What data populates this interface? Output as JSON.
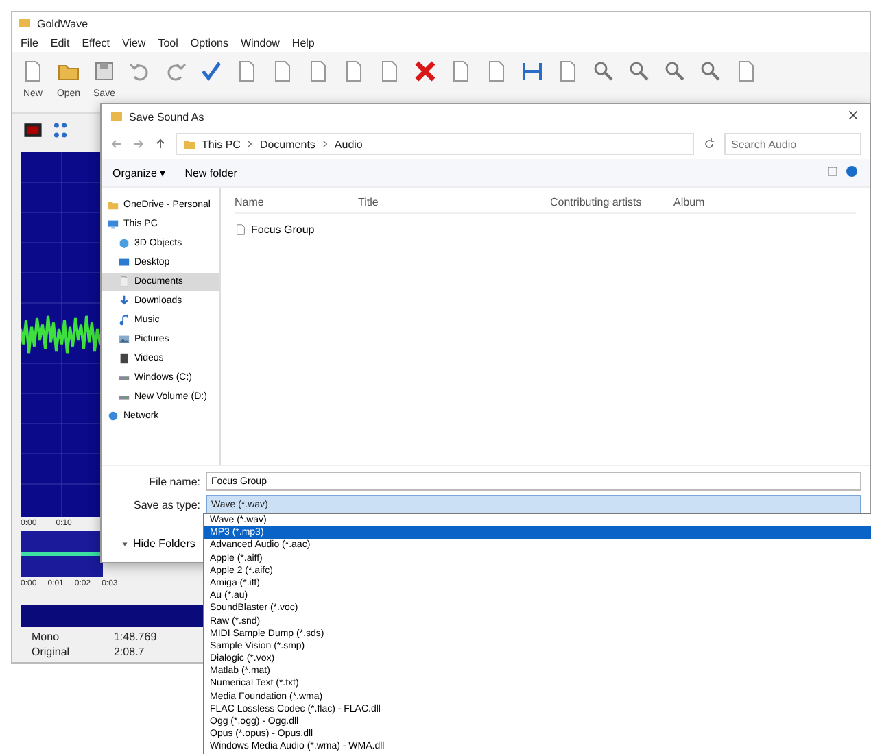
{
  "app": {
    "title": "GoldWave",
    "menu": [
      "File",
      "Edit",
      "Effect",
      "View",
      "Tool",
      "Options",
      "Window",
      "Help"
    ],
    "toolbar": [
      "New",
      "Open",
      "Save"
    ]
  },
  "waveform": {
    "time_labels": [
      "0:00",
      "0:10"
    ],
    "overview_labels": [
      "0:00",
      "0:01",
      "0:02",
      "0:03"
    ]
  },
  "status_bar": [
    {
      "label": "Mono",
      "value": "1:48.769"
    },
    {
      "label": "Original",
      "value": "2:08.7"
    }
  ],
  "dialog": {
    "title": "Save Sound As",
    "path": [
      "This PC",
      "Documents",
      "Audio"
    ],
    "search": {
      "placeholder": "Search Audio"
    },
    "commands": [
      "Organize ▾",
      "New folder"
    ],
    "nav": [
      {
        "label": "OneDrive - Personal",
        "selected": false
      },
      {
        "label": "This PC",
        "selected": false,
        "children": [
          {
            "label": "3D Objects",
            "selected": false
          },
          {
            "label": "Desktop",
            "selected": false
          },
          {
            "label": "Documents",
            "selected": true
          },
          {
            "label": "Downloads",
            "selected": false
          },
          {
            "label": "Music",
            "selected": false
          },
          {
            "label": "Pictures",
            "selected": false
          },
          {
            "label": "Videos",
            "selected": false
          },
          {
            "label": "Windows (C:)",
            "selected": false
          },
          {
            "label": "New Volume (D:)",
            "selected": false
          }
        ]
      },
      {
        "label": "Network",
        "selected": false
      }
    ],
    "columns": [
      "Name",
      "Title",
      "Contributing artists",
      "Album"
    ],
    "files": [
      {
        "name": "Focus Group"
      }
    ],
    "file_name": {
      "label": "File name:",
      "value": "Focus Group"
    },
    "save_type": {
      "label": "Save as type:",
      "value": "Wave (*.wav)"
    },
    "hide_folders": "Hide Folders",
    "type_options": [
      {
        "label": "Wave (*.wav)",
        "selected": false
      },
      {
        "label": "MP3 (*.mp3)",
        "selected": true
      },
      {
        "label": "Advanced Audio (*.aac)",
        "selected": false
      },
      {
        "label": "Apple (*.aiff)",
        "selected": false
      },
      {
        "label": "Apple 2 (*.aifc)",
        "selected": false
      },
      {
        "label": "Amiga (*.iff)",
        "selected": false
      },
      {
        "label": "Au (*.au)",
        "selected": false
      },
      {
        "label": "SoundBlaster (*.voc)",
        "selected": false
      },
      {
        "label": "Raw (*.snd)",
        "selected": false
      },
      {
        "label": "MIDI Sample Dump (*.sds)",
        "selected": false
      },
      {
        "label": "Sample Vision (*.smp)",
        "selected": false
      },
      {
        "label": "Dialogic (*.vox)",
        "selected": false
      },
      {
        "label": "Matlab (*.mat)",
        "selected": false
      },
      {
        "label": "Numerical Text (*.txt)",
        "selected": false
      },
      {
        "label": "Media Foundation (*.wma)",
        "selected": false
      },
      {
        "label": "FLAC Lossless Codec (*.flac) - FLAC.dll",
        "selected": false
      },
      {
        "label": "Ogg (*.ogg) - Ogg.dll",
        "selected": false
      },
      {
        "label": "Opus (*.opus) - Opus.dll",
        "selected": false
      },
      {
        "label": "Windows Media Audio (*.wma) - WMA.dll",
        "selected": false
      }
    ]
  }
}
